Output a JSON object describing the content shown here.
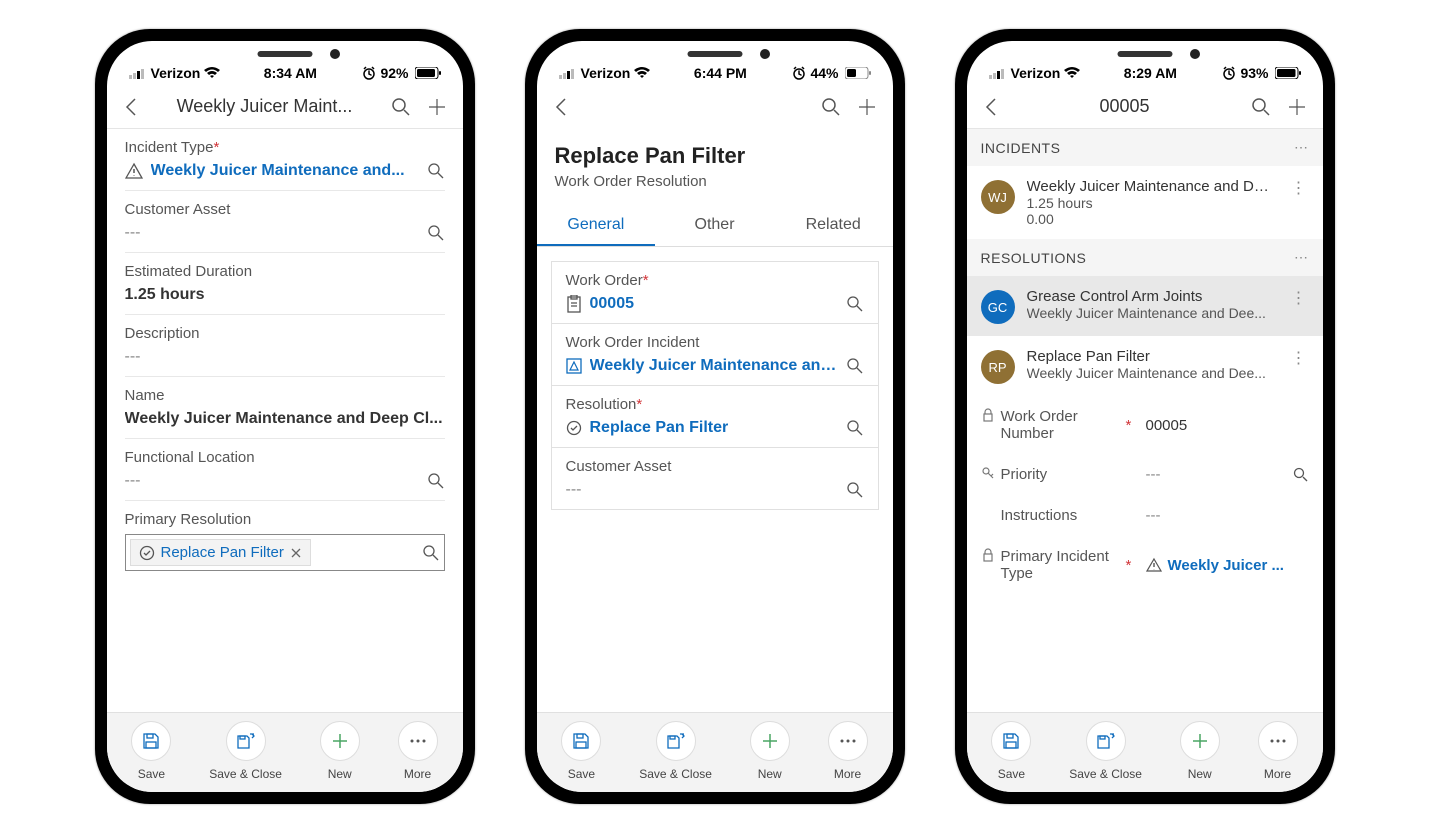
{
  "colors": {
    "link": "#0f6cbd",
    "required": "#d13438"
  },
  "bottomBar": {
    "save": "Save",
    "saveClose": "Save & Close",
    "new": "New",
    "more": "More"
  },
  "phone1": {
    "status": {
      "carrier": "Verizon",
      "time": "8:34 AM",
      "alarm": true,
      "battery": "92%"
    },
    "nav": {
      "title": "Weekly Juicer Maint..."
    },
    "fields": {
      "incidentType": {
        "label": "Incident Type",
        "required": true,
        "value": "Weekly Juicer Maintenance and..."
      },
      "customerAsset": {
        "label": "Customer Asset",
        "value": "---"
      },
      "estimatedDuration": {
        "label": "Estimated Duration",
        "value": "1.25 hours"
      },
      "description": {
        "label": "Description",
        "value": "---"
      },
      "name": {
        "label": "Name",
        "value": "Weekly Juicer Maintenance and Deep Cl..."
      },
      "functionalLocation": {
        "label": "Functional Location",
        "value": "---"
      },
      "primaryResolution": {
        "label": "Primary Resolution",
        "value": "Replace Pan Filter"
      }
    }
  },
  "phone2": {
    "status": {
      "carrier": "Verizon",
      "time": "6:44 PM",
      "alarm": true,
      "battery": "44%"
    },
    "nav": {
      "title": ""
    },
    "header": {
      "title": "Replace Pan Filter",
      "subtitle": "Work Order Resolution"
    },
    "tabs": {
      "general": "General",
      "other": "Other",
      "related": "Related"
    },
    "fields": {
      "workOrder": {
        "label": "Work Order",
        "required": true,
        "value": "00005"
      },
      "workOrderIncident": {
        "label": "Work Order Incident",
        "value": "Weekly Juicer Maintenance and..."
      },
      "resolution": {
        "label": "Resolution",
        "required": true,
        "value": "Replace Pan Filter"
      },
      "customerAsset": {
        "label": "Customer Asset",
        "value": "---"
      }
    }
  },
  "phone3": {
    "status": {
      "carrier": "Verizon",
      "time": "8:29 AM",
      "alarm": true,
      "battery": "93%"
    },
    "nav": {
      "title": "00005"
    },
    "sections": {
      "incidents": {
        "header": "INCIDENTS",
        "items": [
          {
            "avatar": "WJ",
            "color": "#8f7034",
            "title": "Weekly Juicer Maintenance and Dee...",
            "line2": "1.25 hours",
            "line3": "0.00"
          }
        ]
      },
      "resolutions": {
        "header": "RESOLUTIONS",
        "items": [
          {
            "avatar": "GC",
            "color": "#0f6cbd",
            "title": "Grease Control Arm Joints",
            "line2": "Weekly Juicer Maintenance and Dee...",
            "selected": true
          },
          {
            "avatar": "RP",
            "color": "#8f7034",
            "title": "Replace Pan Filter",
            "line2": "Weekly Juicer Maintenance and Dee..."
          }
        ]
      }
    },
    "fields": {
      "workOrderNumber": {
        "label": "Work Order Number",
        "locked": true,
        "required": true,
        "value": "00005"
      },
      "priority": {
        "label": "Priority",
        "value": "---",
        "lookup": true
      },
      "instructions": {
        "label": "Instructions",
        "value": "---"
      },
      "primaryIncidentType": {
        "label": "Primary Incident Type",
        "locked": true,
        "required": true,
        "value": "Weekly Juicer ..."
      }
    }
  }
}
